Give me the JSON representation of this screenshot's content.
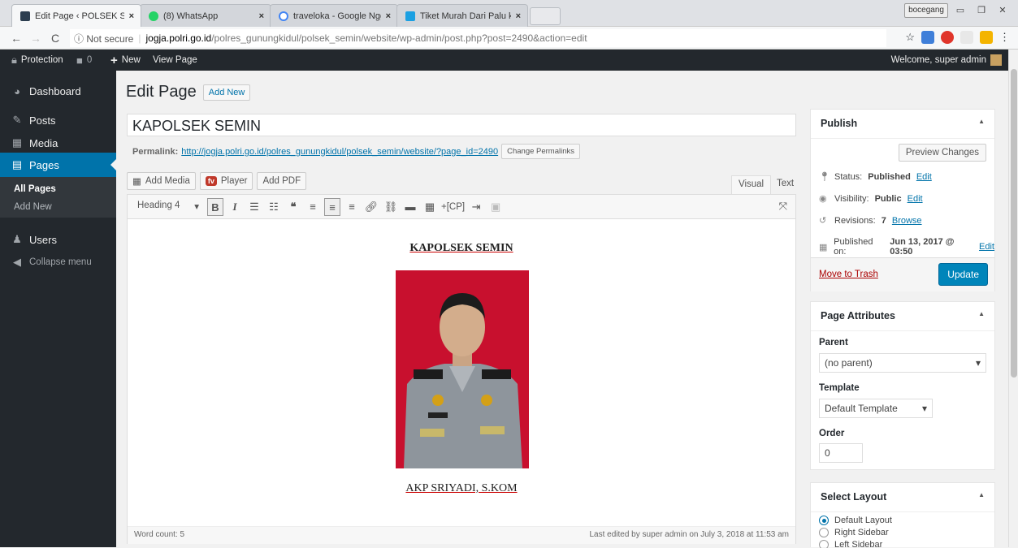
{
  "browser": {
    "tabs": [
      {
        "title": "Edit Page ‹ POLSEK SEMI",
        "color": "#2c3e50"
      },
      {
        "title": "(8) WhatsApp",
        "color": "#25d366"
      },
      {
        "title": "traveloka - Google Nggo",
        "color": "#4285f4"
      },
      {
        "title": "Tiket Murah Dari Palu ke",
        "color": "#1ba0e2"
      }
    ],
    "close_glyph": "×",
    "profile": "bocegang",
    "back": "←",
    "forward": "→",
    "reload": "C",
    "not_secure": "ⓘ Not secure",
    "url_host": "jogja.polri.go.id",
    "url_path": "/polres_gunungkidul/polsek_semin/website/wp-admin/post.php?post=2490&action=edit",
    "star": "☆"
  },
  "adminbar": {
    "protection": "Protection",
    "comments": "0",
    "new": "New",
    "view_page": "View Page",
    "welcome": "Welcome, super admin"
  },
  "sidebar": {
    "dashboard": "Dashboard",
    "posts": "Posts",
    "media": "Media",
    "pages": "Pages",
    "all_pages": "All Pages",
    "add_new": "Add New",
    "users": "Users",
    "collapse": "Collapse menu"
  },
  "page": {
    "heading": "Edit Page",
    "add_new": "Add New",
    "title_value": "KAPOLSEK SEMIN",
    "permalink_label": "Permalink:",
    "permalink_url": "http://jogja.polri.go.id/polres_gunungkidul/polsek_semin/website/?page_id=2490",
    "change_permalinks": "Change Permalinks"
  },
  "editor": {
    "add_media": "Add Media",
    "fv_logo": "fv",
    "player": "Player",
    "add_pdf": "Add PDF",
    "visual_tab": "Visual",
    "text_tab": "Text",
    "format_select": "Heading 4",
    "cp_shortcode": "+[CP]",
    "content_heading": "KAPOLSEK SEMIN",
    "content_caption": "AKP SRIYADI, S.KOM",
    "word_count": "Word count: 5",
    "last_edited": "Last edited by super admin on July 3, 2018 at 11:53 am"
  },
  "publish": {
    "title": "Publish",
    "preview": "Preview Changes",
    "status_label": "Status:",
    "status_value": "Published",
    "visibility_label": "Visibility:",
    "visibility_value": "Public",
    "revisions_label": "Revisions:",
    "revisions_value": "7",
    "browse": "Browse",
    "published_label": "Published on:",
    "published_value": "Jun 13, 2017 @ 03:50",
    "edit": "Edit",
    "trash": "Move to Trash",
    "update": "Update"
  },
  "attributes": {
    "title": "Page Attributes",
    "parent_label": "Parent",
    "parent_value": "(no parent)",
    "template_label": "Template",
    "template_value": "Default Template",
    "order_label": "Order",
    "order_value": "0"
  },
  "layout": {
    "title": "Select Layout",
    "options": [
      "Default Layout",
      "Right Sidebar",
      "Left Sidebar"
    ],
    "selected": "Default Layout"
  },
  "colors": {
    "wp_blue": "#0073aa",
    "admin_dark": "#23282d",
    "photo_bg": "#c8102e"
  }
}
